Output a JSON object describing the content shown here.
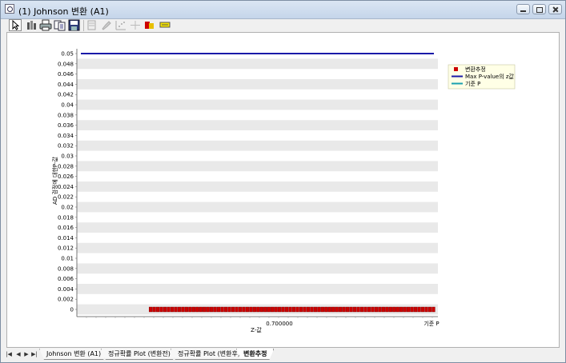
{
  "window": {
    "title": "(1) Johnson 변환 (A1)"
  },
  "toolbar": {
    "buttons": [
      {
        "name": "pointer-tool",
        "enabled": true
      },
      {
        "name": "properties-tool",
        "enabled": true
      },
      {
        "name": "print",
        "enabled": true
      },
      {
        "name": "copy",
        "enabled": true
      },
      {
        "name": "save",
        "enabled": true
      },
      {
        "name": "data-table",
        "enabled": false
      },
      {
        "name": "brush",
        "enabled": false
      },
      {
        "name": "scatter-tool",
        "enabled": false
      },
      {
        "name": "crosshair",
        "enabled": false
      },
      {
        "name": "color-palette",
        "enabled": true
      },
      {
        "name": "label-tool",
        "enabled": true
      }
    ]
  },
  "tabs": {
    "items": [
      {
        "label": "Johnson 변환 (A1)",
        "active": false
      },
      {
        "label": "정규확률 Plot (변환전)",
        "active": false
      },
      {
        "label": "정규확률 Plot (변환후)",
        "active": false
      },
      {
        "label": "변환추정",
        "active": true
      }
    ]
  },
  "chart_data": {
    "type": "line",
    "title": "",
    "xlabel": "Z-값",
    "ylabel": "AD 검정에 대한P-값",
    "ylim": [
      0,
      0.05
    ],
    "y_ticks": [
      "0",
      "0.002",
      "0.004",
      "0.006",
      "0.008",
      "0.01",
      "0.012",
      "0.014",
      "0.016",
      "0.018",
      "0.02",
      "0.022",
      "0.024",
      "0.026",
      "0.028",
      "0.03",
      "0.032",
      "0.034",
      "0.036",
      "0.038",
      "0.04",
      "0.042",
      "0.044",
      "0.046",
      "0.048",
      "0.05"
    ],
    "x_tick_labels": [
      "0.700000",
      "기준 P"
    ],
    "grid": true,
    "legend_position": "right",
    "legend": [
      {
        "name": "변환추정",
        "color": "#cc0000",
        "marker": "square"
      },
      {
        "name": "Max P-value의 z값",
        "color": "#1a1aa8",
        "marker": "line"
      },
      {
        "name": "기준 P",
        "color": "#1aa0b0",
        "marker": "line"
      }
    ],
    "series": [
      {
        "name": "Max P-value의 z값",
        "type": "hline",
        "y": 0.05,
        "color": "#1a1aa8"
      },
      {
        "name": "변환추정",
        "type": "points",
        "y": 0,
        "count": 80,
        "x_start": 0.2,
        "x_end": 1.0,
        "color": "#cc0000"
      }
    ]
  }
}
